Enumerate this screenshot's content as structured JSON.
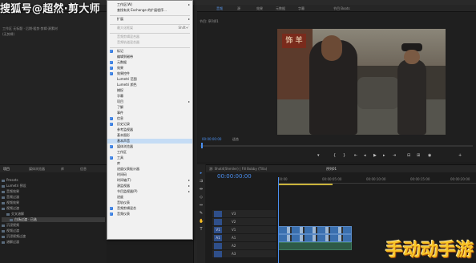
{
  "menubar": {
    "item_left": "↓ 窗口(W)",
    "item_right": "帮助(H)"
  },
  "watermark_top": "搜狐号@超然·剪大师",
  "left_labels": {
    "line1": "工作区 无标题 · 后期·粗剪·剪辑·源素材",
    "line2": "(无剪辑)"
  },
  "menu_items": [
    {
      "label": "工作区(W)",
      "checked": false,
      "arrow": true,
      "disabled": false,
      "shortcut": ""
    },
    {
      "label": "查找有关 Exchange 的扩展程序...",
      "checked": false,
      "arrow": false,
      "disabled": false,
      "shortcut": ""
    },
    {
      "label": "扩展",
      "checked": false,
      "arrow": true,
      "disabled": false,
      "shortcut": ""
    },
    {
      "label": "最大化框架",
      "checked": false,
      "arrow": false,
      "disabled": true,
      "shortcut": "Shift+`"
    },
    {
      "label": "音频剪辑混合器",
      "checked": false,
      "arrow": false,
      "disabled": true,
      "shortcut": ""
    },
    {
      "label": "音频轨道混合器",
      "checked": false,
      "arrow": false,
      "disabled": true,
      "shortcut": ""
    },
    {
      "label": "标记",
      "checked": true,
      "arrow": false,
      "disabled": false,
      "shortcut": ""
    },
    {
      "label": "编辑到磁带",
      "checked": false,
      "arrow": false,
      "disabled": false,
      "shortcut": ""
    },
    {
      "label": "元数据",
      "checked": true,
      "arrow": false,
      "disabled": false,
      "shortcut": ""
    },
    {
      "label": "效果",
      "checked": true,
      "arrow": false,
      "disabled": false,
      "shortcut": ""
    },
    {
      "label": "效果控件",
      "checked": true,
      "arrow": false,
      "disabled": false,
      "shortcut": ""
    },
    {
      "label": "Lumetri 范围",
      "checked": false,
      "arrow": false,
      "disabled": false,
      "shortcut": ""
    },
    {
      "label": "Lumetri 颜色",
      "checked": false,
      "arrow": false,
      "disabled": false,
      "shortcut": ""
    },
    {
      "label": "捕捉",
      "checked": false,
      "arrow": false,
      "disabled": false,
      "shortcut": ""
    },
    {
      "label": "字幕",
      "checked": false,
      "arrow": false,
      "disabled": false,
      "shortcut": ""
    },
    {
      "label": "项目",
      "checked": false,
      "arrow": true,
      "disabled": false,
      "shortcut": ""
    },
    {
      "label": "了解",
      "checked": false,
      "arrow": false,
      "disabled": false,
      "shortcut": ""
    },
    {
      "label": "事件",
      "checked": false,
      "arrow": false,
      "disabled": false,
      "shortcut": ""
    },
    {
      "label": "信息",
      "checked": true,
      "arrow": false,
      "disabled": false,
      "shortcut": ""
    },
    {
      "label": "历史记录",
      "checked": true,
      "arrow": false,
      "disabled": false,
      "shortcut": ""
    },
    {
      "label": "参考监视器",
      "checked": false,
      "arrow": false,
      "disabled": false,
      "shortcut": ""
    },
    {
      "label": "基本图形",
      "checked": false,
      "arrow": false,
      "disabled": false,
      "shortcut": ""
    },
    {
      "label": "基本声音",
      "checked": false,
      "arrow": false,
      "disabled": false,
      "shortcut": "",
      "highlight": true
    },
    {
      "label": "媒体浏览器",
      "checked": true,
      "arrow": false,
      "disabled": false,
      "shortcut": ""
    },
    {
      "label": "工作区",
      "checked": false,
      "arrow": false,
      "disabled": false,
      "shortcut": ""
    },
    {
      "label": "工具",
      "checked": true,
      "arrow": false,
      "disabled": false,
      "shortcut": ""
    },
    {
      "label": "库",
      "checked": false,
      "arrow": false,
      "disabled": false,
      "shortcut": ""
    },
    {
      "label": "进度仪表板计器",
      "checked": false,
      "arrow": false,
      "disabled": false,
      "shortcut": ""
    },
    {
      "label": "时间码",
      "checked": false,
      "arrow": false,
      "disabled": false,
      "shortcut": ""
    },
    {
      "label": "时间轴(T)",
      "checked": false,
      "arrow": true,
      "disabled": false,
      "shortcut": ""
    },
    {
      "label": "源监视器",
      "checked": false,
      "arrow": true,
      "disabled": false,
      "shortcut": ""
    },
    {
      "label": "节目监视器(P)",
      "checked": false,
      "arrow": true,
      "disabled": false,
      "shortcut": ""
    },
    {
      "label": "进度",
      "checked": false,
      "arrow": false,
      "disabled": false,
      "shortcut": ""
    },
    {
      "label": "音轨仪表",
      "checked": false,
      "arrow": false,
      "disabled": false,
      "shortcut": ""
    },
    {
      "label": "音频剪辑混合",
      "checked": true,
      "arrow": false,
      "disabled": false,
      "shortcut": ""
    },
    {
      "label": "音频仪表",
      "checked": true,
      "arrow": false,
      "disabled": false,
      "shortcut": ""
    }
  ],
  "program_monitor": {
    "tabs": [
      "音频",
      "源",
      "效果",
      "元数据",
      "字幕",
      "节目 Boots"
    ],
    "sequence_label": "节目: 序列01",
    "timecode": "00:00:00:00",
    "fit_label": "适合",
    "sign_text": "饰 羊"
  },
  "project_panel": {
    "tabs": [
      "项目",
      "媒体浏览器",
      "库",
      "信息"
    ],
    "rows": [
      {
        "label": "Presets",
        "selected": false
      },
      {
        "label": "Lumetri 预设",
        "selected": false
      },
      {
        "label": "音频效果",
        "selected": false
      },
      {
        "label": "音频过渡",
        "selected": false
      },
      {
        "label": "视频效果",
        "selected": false
      },
      {
        "label": "视频过渡",
        "selected": false
      },
      {
        "label": "交叉溶解",
        "selected": false
      },
      {
        "label": "白场过渡 · 已选",
        "selected": true
      },
      {
        "label": "沉浸视频",
        "selected": false
      },
      {
        "label": "视频过渡",
        "selected": false
      },
      {
        "label": "沉浸视频过渡",
        "selected": false
      },
      {
        "label": "溶解过渡",
        "selected": false
      }
    ]
  },
  "timeline": {
    "tabs": [
      "源: Shot4(Shmiler) | Fill Bobby (Tilla)",
      "序列01"
    ],
    "timecode": "00:00:00:00",
    "ruler": [
      "00:00",
      "00:00:05:00",
      "00:00:10:00",
      "00:00:15:00",
      "00:00:20:00"
    ],
    "tracks": [
      {
        "name": "V3",
        "src": ""
      },
      {
        "name": "V2",
        "src": ""
      },
      {
        "name": "V1",
        "src": "V1"
      },
      {
        "name": "A1",
        "src": "A1"
      },
      {
        "name": "A2",
        "src": ""
      },
      {
        "name": "A3",
        "src": ""
      }
    ]
  },
  "big_watermark": "手动动手游",
  "colors": {
    "accent": "#4a8ff0",
    "menu_bg": "#f1f1f1",
    "highlight": "#c5dcf5",
    "watermark_gold": "#f7c325"
  }
}
